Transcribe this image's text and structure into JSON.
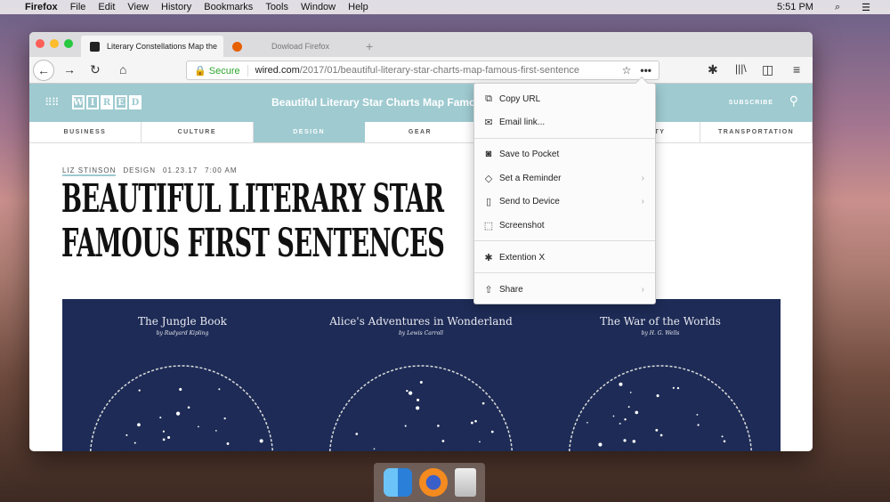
{
  "menubar": {
    "app": "Firefox",
    "items": [
      "File",
      "Edit",
      "View",
      "History",
      "Bookmarks",
      "Tools",
      "Window",
      "Help"
    ],
    "time": "5:51 PM"
  },
  "tabs": [
    {
      "label": "Literary Constellations Map the"
    },
    {
      "label": "Dowload Firefox"
    }
  ],
  "toolbar": {
    "secure": "Secure",
    "url_domain": "wired.com",
    "url_path": "/2017/01/beautiful-literary-star-charts-map-famous-first-sentence"
  },
  "site": {
    "title": "Beautiful Literary Star Charts Map Famous",
    "subscribe": "SUBSCRIBE",
    "logo": "WIRED",
    "nav": [
      "BUSINESS",
      "CULTURE",
      "DESIGN",
      "GEAR",
      "",
      "SECURITY",
      "TRANSPORTATION"
    ],
    "byline": {
      "author": "LIZ STINSON",
      "section": "DESIGN",
      "date": "01.23.17",
      "time": "7:00 AM"
    },
    "headline1": "BEAUTIFUL LITERARY STAR",
    "headline2": "FAMOUS FIRST SENTENCES",
    "books": [
      {
        "title": "The Jungle Book",
        "author": "by Rudyard Kipling"
      },
      {
        "title": "Alice's Adventures in Wonderland",
        "author": "by Lewis Carroll"
      },
      {
        "title": "The War of the Worlds",
        "author": "by H. G. Wells"
      }
    ]
  },
  "page_menu": {
    "items": [
      {
        "label": "Copy URL",
        "icon": "copy-icon"
      },
      {
        "label": "Email link...",
        "icon": "email-icon"
      },
      {
        "label": "Save to Pocket",
        "icon": "pocket-icon"
      },
      {
        "label": "Set a Reminder",
        "icon": "reminder-icon"
      },
      {
        "label": "Send to Device",
        "icon": "device-icon"
      },
      {
        "label": "Screenshot",
        "icon": "screenshot-icon"
      },
      {
        "label": "Extention X",
        "icon": "extension-icon"
      },
      {
        "label": "Share",
        "icon": "share-icon"
      }
    ]
  }
}
